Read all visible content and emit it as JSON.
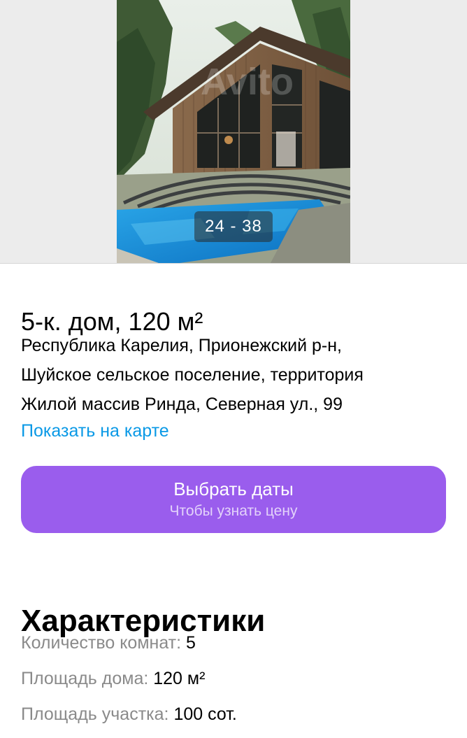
{
  "gallery": {
    "counter": "24 - 38",
    "watermark": "Avito"
  },
  "listing": {
    "title": "5-к. дом, 120 м²",
    "address_lines": [
      "Республика Карелия, Прионежский р-н,",
      "Шуйское сельское поселение, территория",
      "Жилой массив Ринда, Северная ул., 99"
    ],
    "map_link": "Показать на карте"
  },
  "cta": {
    "label": "Выбрать даты",
    "sublabel": "Чтобы узнать цену"
  },
  "characteristics": {
    "title": "Характеристики",
    "items": [
      {
        "label": "Количество комнат:",
        "value": "5"
      },
      {
        "label": "Площадь дома:",
        "value": "120 м²"
      },
      {
        "label": "Площадь участка:",
        "value": "100 сот."
      }
    ]
  },
  "colors": {
    "accent": "#9a5ded",
    "link": "#0a99e6",
    "muted": "#8a8a8a"
  }
}
